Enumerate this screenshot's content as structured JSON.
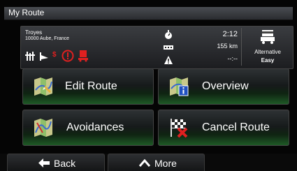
{
  "window": {
    "title": "My Route"
  },
  "route_info": {
    "destination_line1": "Troyes",
    "destination_line2": "10000 Aube, France",
    "warning_icons": [
      "toll-road-icon",
      "ferry-icon",
      "toll-cost-icon",
      "restriction-warning-icon",
      "truck-restriction-icon"
    ],
    "time_value": "2:12",
    "distance_value": "155 km",
    "delay_value": "--:--"
  },
  "route_type": {
    "label": "Alternative",
    "value": "Easy"
  },
  "buttons": {
    "edit_route": "Edit Route",
    "overview": "Overview",
    "avoidances": "Avoidances",
    "cancel_route": "Cancel Route"
  },
  "bottom_bar": {
    "back_label": "Back",
    "more_label": "More"
  },
  "colors": {
    "accent_green": "#1e5a26",
    "warning_red": "#e02020",
    "panel": "#2b2d30"
  }
}
